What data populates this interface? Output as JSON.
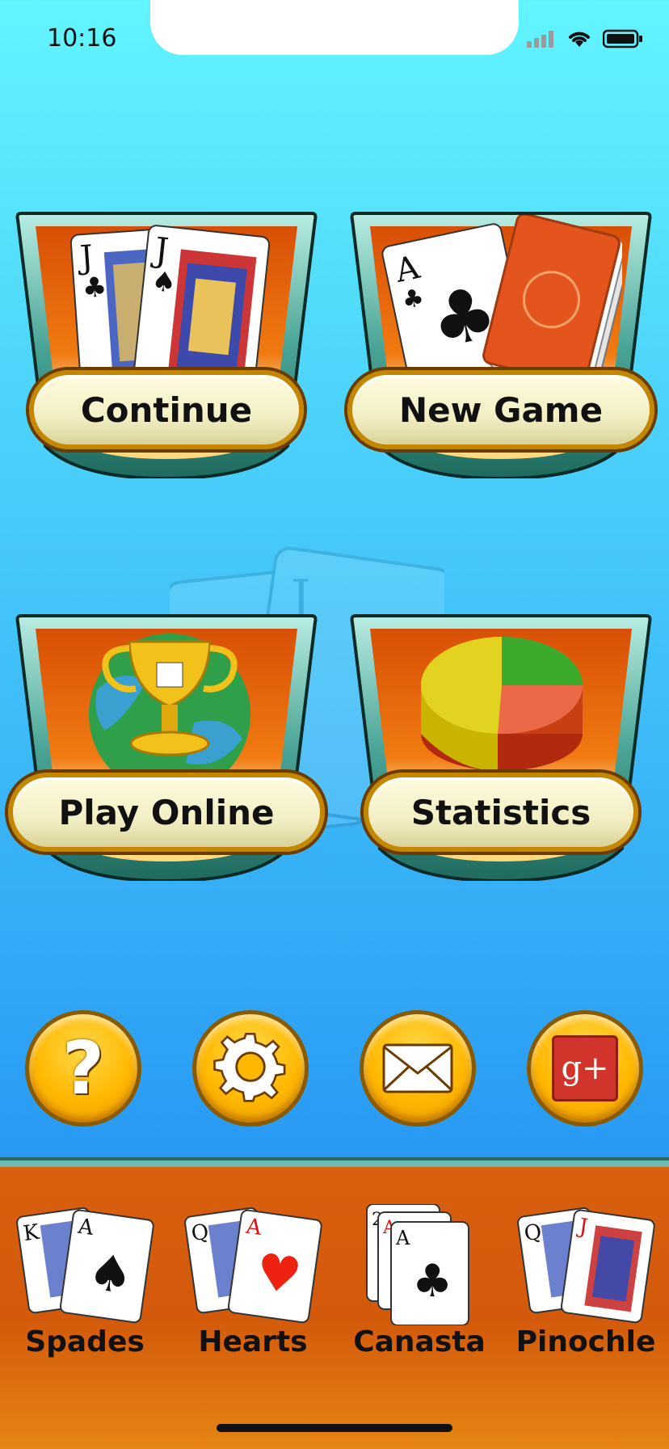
{
  "status_bar": {
    "time": "10:16"
  },
  "tiles": {
    "continue": "Continue",
    "new_game": "New Game",
    "play_online": "Play Online",
    "statistics": "Statistics"
  },
  "icons": {
    "help": "question-icon",
    "settings": "gear-icon",
    "mail": "mail-icon",
    "google_plus": "google-plus-icon",
    "google_plus_text": "g+"
  },
  "games": [
    {
      "label": "Spades"
    },
    {
      "label": "Hearts"
    },
    {
      "label": "Canasta"
    },
    {
      "label": "Pinochle"
    }
  ],
  "colors": {
    "background_top": "#62f5ff",
    "background_bottom": "#2a92ee",
    "bottom_bar": "#d35a0b",
    "button_gold": "#ffb800"
  }
}
